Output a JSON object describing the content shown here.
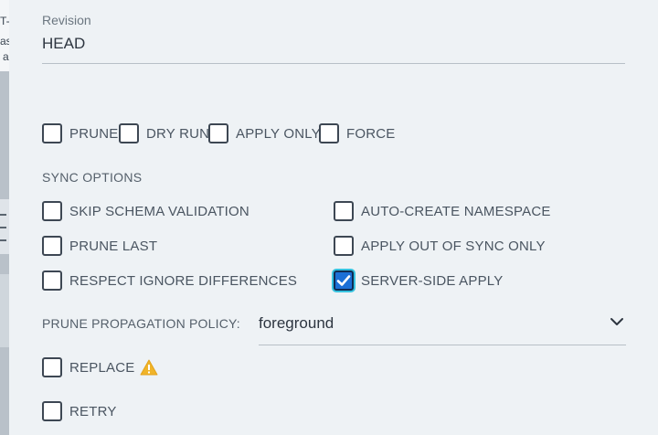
{
  "background_fragments": {
    "line1": "T-",
    "line2": "as",
    "line3": "a"
  },
  "revision": {
    "label": "Revision",
    "value": "HEAD"
  },
  "sync_modes": [
    {
      "label": "PRUNE",
      "checked": false
    },
    {
      "label": "DRY RUN",
      "checked": false
    },
    {
      "label": "APPLY ONLY",
      "checked": false
    },
    {
      "label": "FORCE",
      "checked": false
    }
  ],
  "sync_options": {
    "title": "SYNC OPTIONS",
    "left": [
      {
        "label": "SKIP SCHEMA VALIDATION",
        "checked": false
      },
      {
        "label": "PRUNE LAST",
        "checked": false
      },
      {
        "label": "RESPECT IGNORE DIFFERENCES",
        "checked": false
      }
    ],
    "right": [
      {
        "label": "AUTO-CREATE NAMESPACE",
        "checked": false
      },
      {
        "label": "APPLY OUT OF SYNC ONLY",
        "checked": false
      },
      {
        "label": "SERVER-SIDE APPLY",
        "checked": true
      }
    ]
  },
  "prune_propagation_policy": {
    "label": "PRUNE PROPAGATION POLICY:",
    "value": "foreground"
  },
  "replace": {
    "label": "REPLACE",
    "checked": false,
    "icon": "warning-icon"
  },
  "retry": {
    "label": "RETRY",
    "checked": false
  },
  "colors": {
    "accent": "#1b6fd6",
    "focus_ring": "#37c3df",
    "warning": "#f0b429"
  }
}
